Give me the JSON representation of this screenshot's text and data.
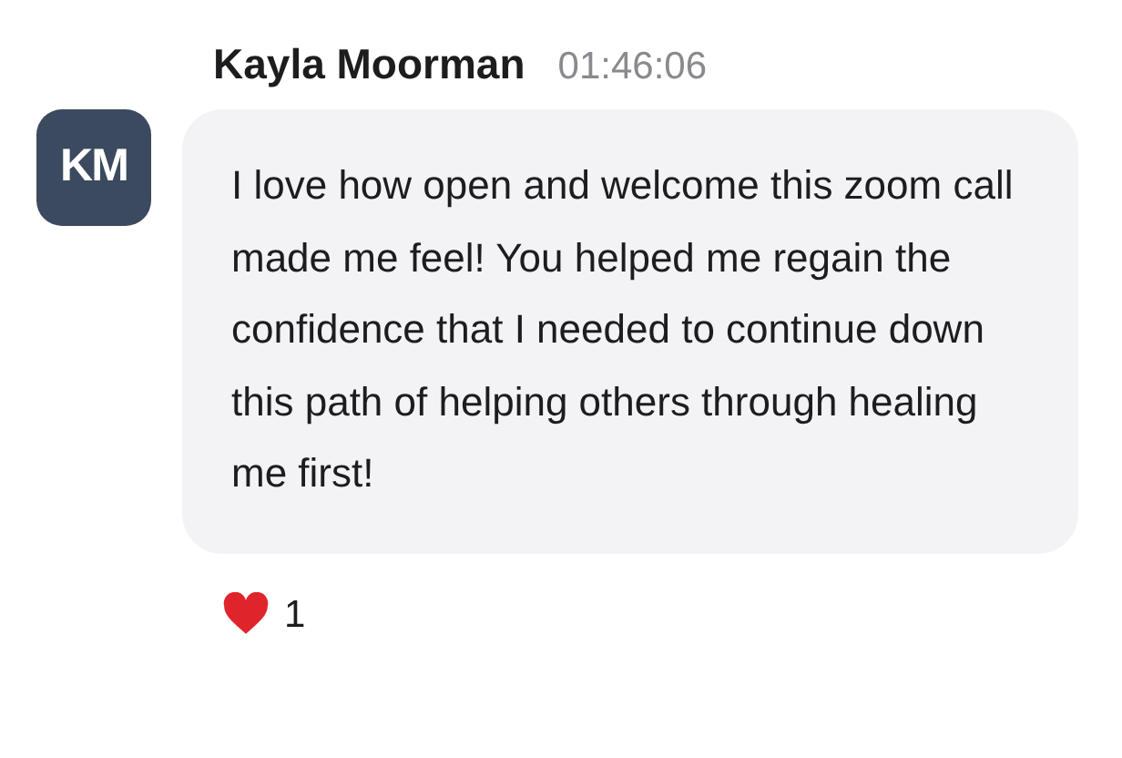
{
  "message": {
    "avatar_initials": "KM",
    "author": "Kayla Moorman",
    "time": "01:46:06",
    "text": "I love how open and welcome this zoom call made me feel! You helped me regain the confidence that I needed to continue down this path of helping others through healing me first!"
  },
  "reactions": [
    {
      "kind": "heart",
      "count": "1"
    }
  ]
}
